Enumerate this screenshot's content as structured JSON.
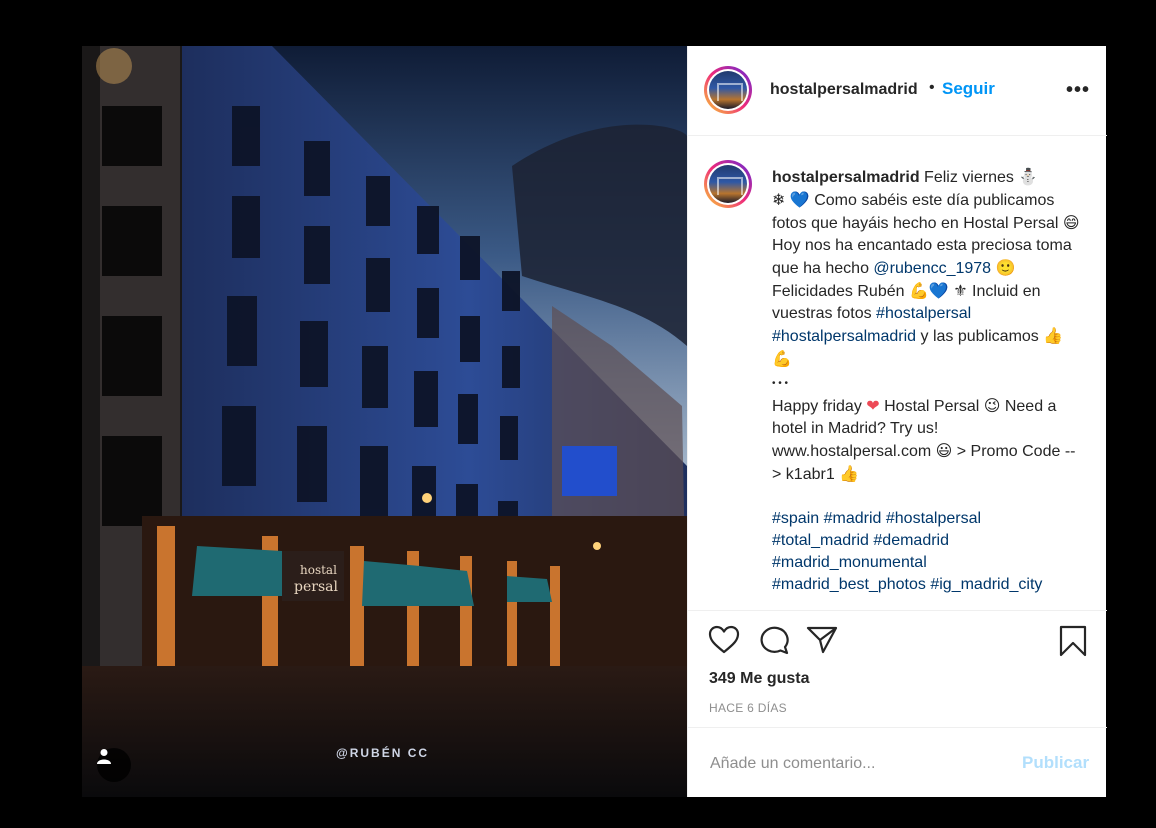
{
  "post": {
    "username": "hostalpersalmadrid",
    "follow_label": "Seguir",
    "dot": "•",
    "more_label": "•••",
    "watermark": "@RUBÉN CC",
    "likes": "349 Me gusta",
    "time": "HACE 6 DÍAS"
  },
  "caption": {
    "username": "hostalpersalmadrid",
    "t1": " Feliz viernes ",
    "e1": "⛄",
    "e2": "❄",
    "e3": "💙",
    "t2": " Como sabéis este día publicamos fotos que hayáis hecho en Hostal Persal ",
    "e4": "😄",
    "t3": " Hoy nos ha encantado esta preciosa toma que ha hecho ",
    "mention": "@rubencc_1978",
    "e5": "🙂",
    "t4": " Felicidades Rubén ",
    "e6": "💪",
    "e7": "💙",
    "e8": "⚜",
    "t5": " Incluid en vuestras fotos ",
    "tag1": "#hostalpersal",
    "tag2": "#hostalpersalmadrid",
    "t6": " y las publicamos ",
    "e9": "👍",
    "e10": "💪",
    "dots": "•  •  •",
    "t7": "Happy friday ",
    "e11": "❤",
    "t8": " Hostal Persal ",
    "e12": "😉",
    "t9": " Need a hotel in Madrid? Try us! www.hostalpersal.com ",
    "e13": "😃",
    "t10": " > Promo Code --> k1abr1 ",
    "e14": "👍",
    "h1": "#spain",
    "h2": "#madrid",
    "h3": "#hostalpersal",
    "h4": "#total_madrid",
    "h5": "#demadrid",
    "h6": "#madrid_monumental",
    "h7": "#madrid_best_photos",
    "h8": "#ig_madrid_city"
  },
  "comment_box": {
    "placeholder": "Añade un comentario...",
    "publish_label": "Publicar"
  },
  "icons": {
    "like": "heart-icon",
    "comment": "comment-icon",
    "share": "share-icon",
    "save": "bookmark-icon",
    "user_tag": "user-icon"
  },
  "colors": {
    "accent": "#0095f6",
    "link": "#00376b",
    "muted": "#8e8e8e",
    "publish_disabled": "#b2dffc"
  }
}
